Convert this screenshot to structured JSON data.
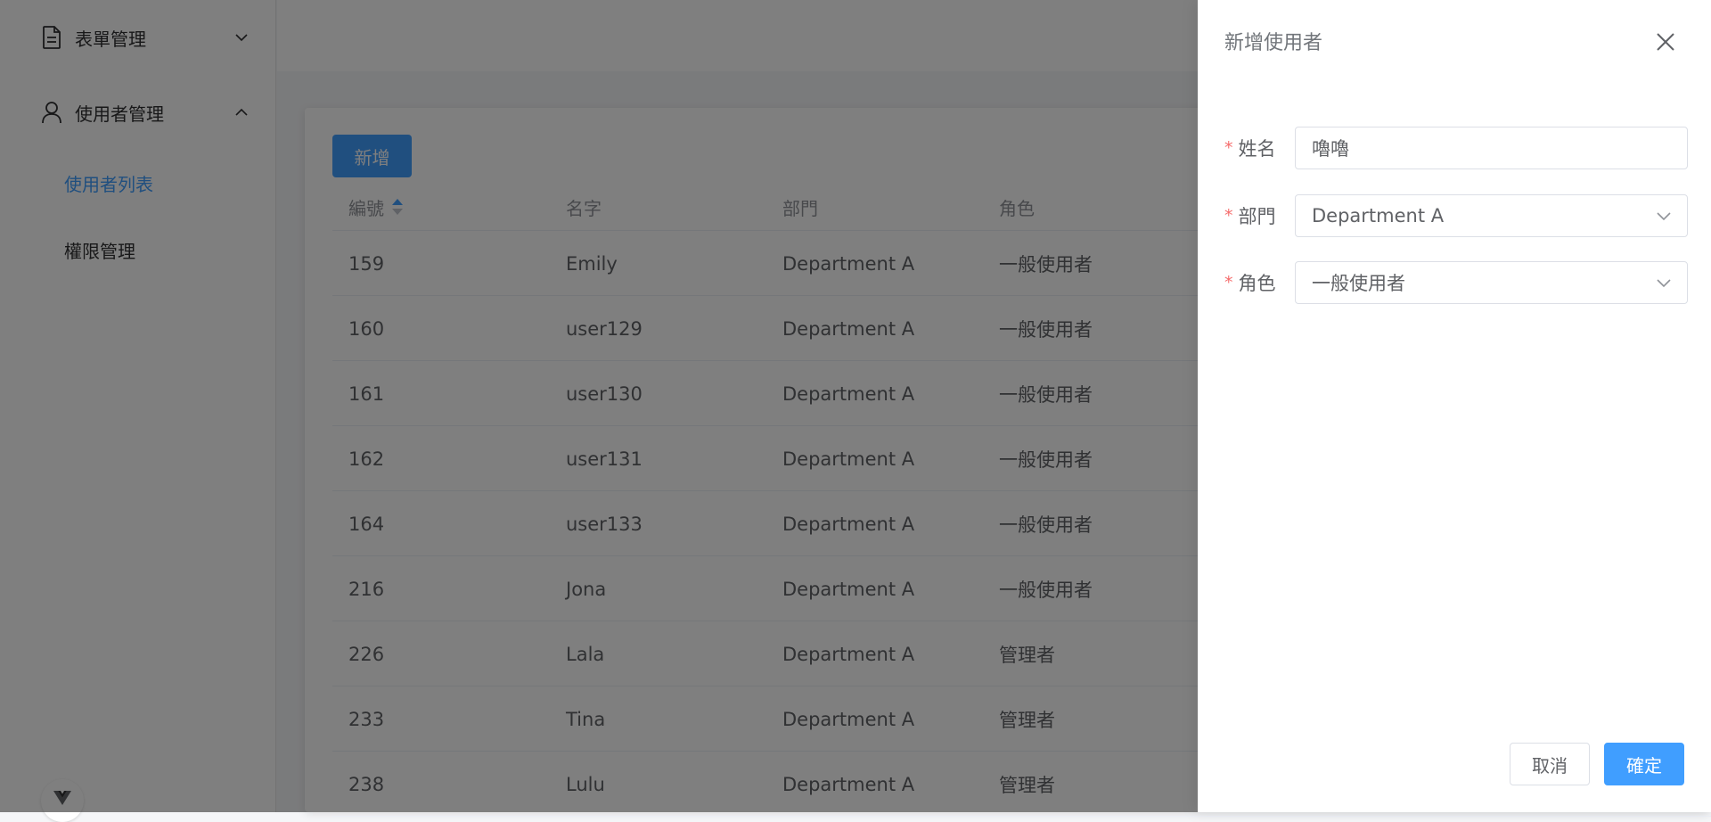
{
  "sidebar": {
    "groups": [
      {
        "label": "表單管理",
        "icon": "document-icon",
        "expanded": false
      },
      {
        "label": "使用者管理",
        "icon": "user-icon",
        "expanded": true
      }
    ],
    "subitems": [
      {
        "label": "使用者列表",
        "active": true
      },
      {
        "label": "權限管理",
        "active": false
      }
    ]
  },
  "main": {
    "add_label": "新增",
    "table": {
      "headers": [
        "編號",
        "名字",
        "部門",
        "角色"
      ],
      "rows": [
        {
          "id": "159",
          "name": "Emily",
          "dept": "Department A",
          "role": "一般使用者"
        },
        {
          "id": "160",
          "name": "user129",
          "dept": "Department A",
          "role": "一般使用者"
        },
        {
          "id": "161",
          "name": "user130",
          "dept": "Department A",
          "role": "一般使用者"
        },
        {
          "id": "162",
          "name": "user131",
          "dept": "Department A",
          "role": "一般使用者"
        },
        {
          "id": "164",
          "name": "user133",
          "dept": "Department A",
          "role": "一般使用者"
        },
        {
          "id": "216",
          "name": "Jona",
          "dept": "Department A",
          "role": "一般使用者"
        },
        {
          "id": "226",
          "name": "Lala",
          "dept": "Department A",
          "role": "管理者"
        },
        {
          "id": "233",
          "name": "Tina",
          "dept": "Department A",
          "role": "管理者"
        },
        {
          "id": "238",
          "name": "Lulu",
          "dept": "Department A",
          "role": "管理者"
        }
      ]
    }
  },
  "drawer": {
    "title": "新增使用者",
    "fields": {
      "name": {
        "label": "姓名",
        "value": "嚕嚕",
        "required": "*"
      },
      "dept": {
        "label": "部門",
        "value": "Department A",
        "required": "*"
      },
      "role": {
        "label": "角色",
        "value": "一般使用者",
        "required": "*"
      }
    },
    "cancel_label": "取消",
    "ok_label": "確定"
  },
  "colors": {
    "primary": "#409eff",
    "required": "#f56c6c",
    "overlay": "rgba(0,0,0,0.5)"
  }
}
